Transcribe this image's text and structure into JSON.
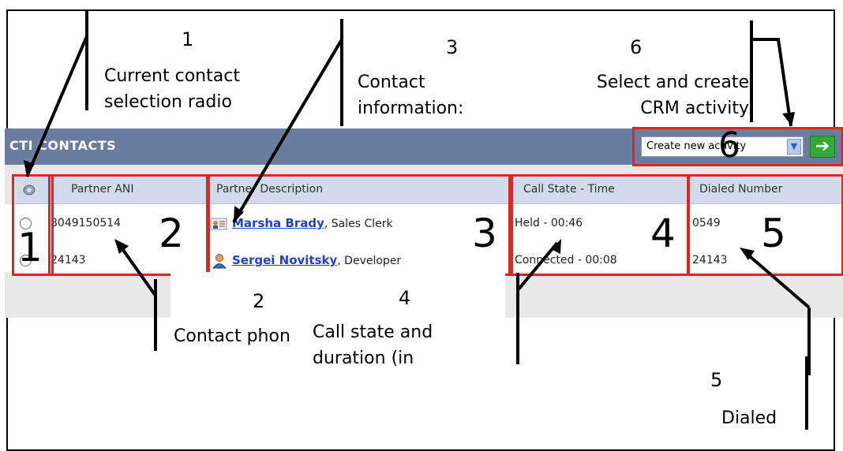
{
  "callouts": {
    "c1": {
      "num": "1",
      "text1": "Current contact",
      "text2": "selection radio"
    },
    "c2": {
      "num": "2",
      "text1": "Contact phon"
    },
    "c3": {
      "num": "3",
      "text1": "Contact",
      "text2": "information:"
    },
    "c4": {
      "num": "4",
      "text1": "Call state and",
      "text2": "duration (in"
    },
    "c5": {
      "num": "5",
      "text1": "Dialed"
    },
    "c6": {
      "num": "6",
      "text1": "Select and create",
      "text2": "CRM activity"
    }
  },
  "panel": {
    "title": "CTI CONTACTS",
    "activity_select": "Create new activity",
    "go_glyph": "➔"
  },
  "columns": {
    "radio_icon": "phone-icon",
    "partner_ani": "Partner ANI",
    "partner_description": "Partner Description",
    "call_state": "Call State - Time",
    "dialed_number": "Dialed Number"
  },
  "rows": [
    {
      "ani": "8049150514",
      "name": "Marsha Brady",
      "role": ", Sales Clerk",
      "state": "Held - 00:46",
      "dialed": "0549",
      "icon": "contact-card-icon"
    },
    {
      "ani": "24143",
      "name": "Sergei Novitsky",
      "role": ", Developer",
      "state": "Connected - 00:08",
      "dialed": "24143",
      "icon": "person-icon"
    }
  ],
  "box_numbers": {
    "n1": "1",
    "n2": "2",
    "n3": "3",
    "n4": "4",
    "n5": "5",
    "n6": "6"
  }
}
